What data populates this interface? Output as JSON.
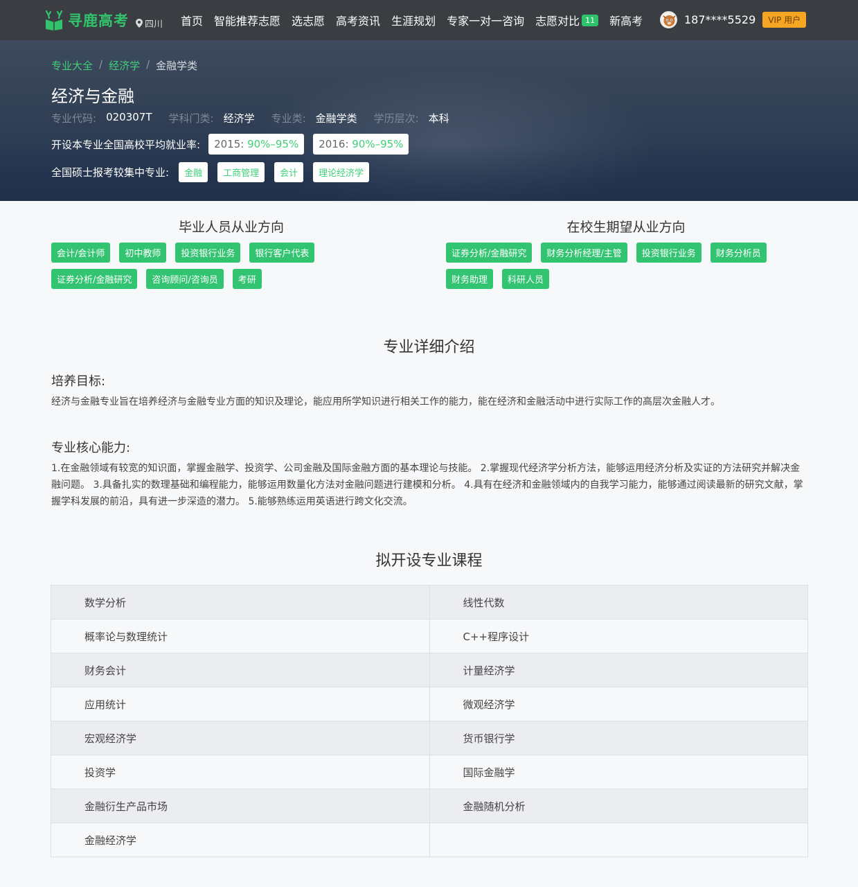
{
  "header": {
    "logo_text": "寻鹿高考",
    "location": "四川",
    "menu": [
      {
        "label": "首页"
      },
      {
        "label": "智能推荐志愿"
      },
      {
        "label": "选志愿"
      },
      {
        "label": "高考资讯"
      },
      {
        "label": "生涯规划"
      },
      {
        "label": "专家一对一咨询"
      },
      {
        "label": "志愿对比",
        "badge": "11"
      },
      {
        "label": "新高考"
      }
    ],
    "user_phone": "187****5529",
    "vip_label": "VIP 用户"
  },
  "breadcrumb": [
    "专业大全",
    "经济学",
    "金融学类"
  ],
  "major": {
    "title": "经济与金融",
    "code_key": "专业代码:",
    "code": "020307T",
    "category_key": "学科门类:",
    "category": "经济学",
    "class_key": "专业类:",
    "class": "金融学类",
    "level_key": "学历层次:",
    "level": "本科"
  },
  "employment": {
    "label": "开设本专业全国高校平均就业率:",
    "rates": [
      {
        "year": "2015:",
        "rate": "90%–95%"
      },
      {
        "year": "2016:",
        "rate": "90%–95%"
      }
    ]
  },
  "graduate": {
    "label": "全国硕士报考较集中专业:",
    "majors": [
      "金融",
      "工商管理",
      "会计",
      "理论经济学"
    ]
  },
  "directions": {
    "graduates_title": "毕业人员从业方向",
    "graduates": [
      "会计/会计师",
      "初中教师",
      "投资银行业务",
      "银行客户代表",
      "证券分析/金融研究",
      "咨询顾问/咨询员",
      "考研"
    ],
    "students_title": "在校生期望从业方向",
    "students": [
      "证券分析/金融研究",
      "财务分析经理/主管",
      "投资银行业务",
      "财务分析员",
      "财务助理",
      "科研人员"
    ]
  },
  "detail": {
    "section_title": "专业详细介绍",
    "goal_title": "培养目标:",
    "goal_text": "经济与金融专业旨在培养经济与金融专业方面的知识及理论，能应用所学知识进行相关工作的能力，能在经济和金融活动中进行实际工作的高层次金融人才。",
    "ability_title": "专业核心能力:",
    "ability_text": "1.在金融领域有较宽的知识面，掌握金融学、投资学、公司金融及国际金融方面的基本理论与技能。 2.掌握现代经济学分析方法，能够运用经济分析及实证的方法研究并解决金融问题。 3.具备扎实的数理基础和编程能力，能够运用数量化方法对金融问题进行建模和分析。 4.具有在经济和金融领域内的自我学习能力，能够通过阅读最新的研究文献，掌握学科发展的前沿，具有进一步深造的潜力。 5.能够熟练运用英语进行跨文化交流。"
  },
  "courses": {
    "section_title": "拟开设专业课程",
    "rows": [
      [
        "数学分析",
        "线性代数"
      ],
      [
        "概率论与数理统计",
        "C++程序设计"
      ],
      [
        "财务会计",
        "计量经济学"
      ],
      [
        "应用统计",
        "微观经济学"
      ],
      [
        "宏观经济学",
        "货币银行学"
      ],
      [
        "投资学",
        "国际金融学"
      ],
      [
        "金融衍生产品市场",
        "金融随机分析"
      ],
      [
        "金融经济学",
        ""
      ]
    ]
  },
  "colors": {
    "brand": "#32c36c",
    "nav_bg": "#3a3d42",
    "vip": "#f6a623"
  }
}
